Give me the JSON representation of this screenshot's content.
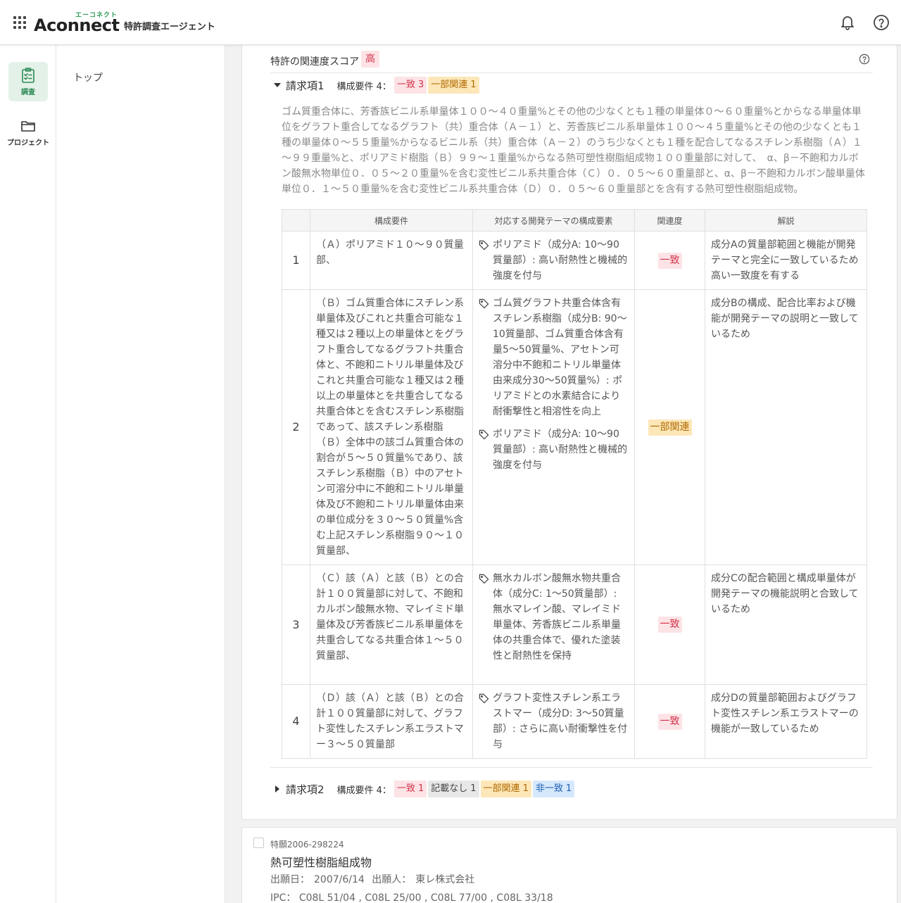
{
  "header": {
    "logo_ruby": "エーコネクト",
    "logo_main": "Aconnect",
    "logo_sub": "特許調査エージェント"
  },
  "rail": {
    "items": [
      {
        "label": "調査",
        "icon": "clipboard-check-icon"
      },
      {
        "label": "プロジェクト",
        "icon": "folder-icon"
      }
    ]
  },
  "sidebar": {
    "top_label": "トップ"
  },
  "score": {
    "label": "特許の関連度スコア",
    "value": "高"
  },
  "claim1": {
    "title": "請求項1",
    "req_label": "構成要件 4：",
    "counts": [
      {
        "label": "一致",
        "n": "3",
        "kind": "match"
      },
      {
        "label": "一部関連",
        "n": "1",
        "kind": "partial"
      }
    ],
    "text": "ゴム質重合体に、芳香族ビニル系単量体１００～４０重量%とその他の少なくとも１種の単量体０～６０重量%とからなる単量体単位をグラフト重合してなるグラフト（共）重合体（Ａ－１）と、芳香族ビニル系単量体１００～４５重量%とその他の少なくとも１種の単量体０～５５重量%からなるビニル系（共）重合体（Ａ－２）のうち少なくとも１種を配合してなるスチレン系樹脂（Ａ）１～９９重量%と、ポリアミド樹脂（Ｂ）９９～１重量%からなる熱可塑性樹脂組成物１００重量部に対して、　α、β－不飽和カルボン酸無水物単位０．０５～２０重量%を含む変性ビニル系共重合体（Ｃ）０．０５～６０重量部と、α、β－不飽和カルボン酸単量体単位０．１～５０重量%を含む変性ビニル系共重合体（Ｄ）０．０５～６０重量部とを含有する熱可塑性樹脂組成物。",
    "table": {
      "headers": [
        "",
        "構成要件",
        "対応する開発テーマの構成要素",
        "関連度",
        "解説"
      ],
      "rows": [
        {
          "num": "1",
          "requirement": "（Ａ）ポリアミド１０～９０質量部、",
          "themes": [
            "ポリアミド（成分A: 10〜90質量部）: 高い耐熱性と機械的強度を付与"
          ],
          "relevance": "一致",
          "kind": "match",
          "explanation": "成分Aの質量部範囲と機能が開発テーマと完全に一致しているため高い一致度を有する"
        },
        {
          "num": "2",
          "requirement": "（Ｂ）ゴム質重合体にスチレン系単量体及びこれと共重合可能な１種又は２種以上の単量体とをグラフト重合してなるグラフト共重合体と、不飽和ニトリル単量体及びこれと共重合可能な１種又は２種以上の単量体とを共重合してなる共重合体とを含むスチレン系樹脂であって、該スチレン系樹脂（Ｂ）全体中の該ゴム質重合体の割合が５～５０質量%であり、該スチレン系樹脂（Ｂ）中のアセトン可溶分中に不飽和ニトリル単量体及び不飽和ニトリル単量体由来の単位成分を３０～５０質量%含む上記スチレン系樹脂９０～１０質量部、",
          "themes": [
            "ゴム質グラフト共重合体含有スチレン系樹脂（成分B: 90〜10質量部、ゴム質重合体含有量5〜50質量%、アセトン可溶分中不飽和ニトリル単量体由来成分30〜50質量%）: ポリアミドとの水素結合により耐衝撃性と相溶性を向上",
            "ポリアミド（成分A: 10〜90質量部）: 高い耐熱性と機械的強度を付与"
          ],
          "relevance": "一部関連",
          "kind": "partial",
          "explanation": "成分Bの構成、配合比率および機能が開発テーマの説明と一致しているため"
        },
        {
          "num": "3",
          "requirement": "（Ｃ）該（Ａ）と該（Ｂ）との合計１００質量部に対して、不飽和カルボン酸無水物、マレイミド単量体及び芳香族ビニル系単量体を共重合してなる共重合体１～５０質量部、",
          "themes": [
            "無水カルボン酸無水物共重合体（成分C: 1〜50質量部）: 無水マレイン酸、マレイミド単量体、芳香族ビニル系単量体の共重合体で、優れた塗装性と耐熱性を保持"
          ],
          "relevance": "一致",
          "kind": "match",
          "explanation": "成分Cの配合範囲と構成単量体が開発テーマの機能説明と合致しているため"
        },
        {
          "num": "4",
          "requirement": "（Ｄ）該（Ａ）と該（Ｂ）との合計１００質量部に対して、グラフト変性したスチレン系エラストマー３～５０質量部",
          "themes": [
            "グラフト変性スチレン系エラストマー（成分D: 3〜50質量部）: さらに高い耐衝撃性を付与"
          ],
          "relevance": "一致",
          "kind": "match",
          "explanation": "成分Dの質量部範囲およびグラフト変性スチレン系エラストマーの機能が一致しているため"
        }
      ]
    }
  },
  "claim2": {
    "title": "請求項2",
    "req_label": "構成要件 4：",
    "counts": [
      {
        "label": "一致",
        "n": "1",
        "kind": "match"
      },
      {
        "label": "記載なし",
        "n": "1",
        "kind": "none"
      },
      {
        "label": "一部関連",
        "n": "1",
        "kind": "partial"
      },
      {
        "label": "非一致",
        "n": "1",
        "kind": "nomatch"
      }
    ]
  },
  "patent2": {
    "number": "特願2006-298224",
    "title": "熱可塑性樹脂組成物",
    "date_label": "出願日：",
    "date": "2007/6/14",
    "applicant_label": "出願人：",
    "applicant": "東レ株式会社",
    "ipc_label": "IPC：",
    "ipc": "C08L 51/04 , C08L 25/00 , C08L 77/00 , C08L 33/18"
  }
}
